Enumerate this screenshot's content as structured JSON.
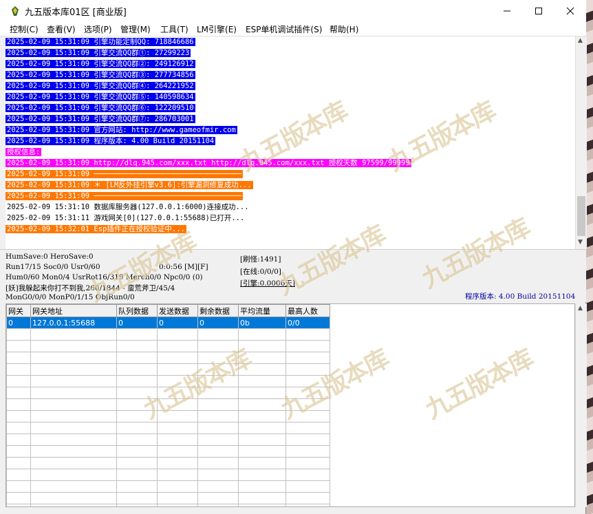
{
  "window": {
    "title": "九五版本库01区 [商业版]"
  },
  "menu": [
    "控制(C)",
    "查看(V)",
    "选项(P)",
    "管理(M)",
    "工具(T)",
    "LM引擎(E)",
    "ESP单机调试插件(S)",
    "帮助(H)"
  ],
  "log": [
    {
      "text": "2025-02-09 15:31:09 引擎功能定制QQ: 718846686",
      "style": "blue"
    },
    {
      "text": "2025-02-09 15:31:09 引擎交流QQ群①: 27299223",
      "style": "blue"
    },
    {
      "text": "2025-02-09 15:31:09 引擎交流QQ群②: 249126912",
      "style": "blue"
    },
    {
      "text": "2025-02-09 15:31:09 引擎交流QQ群③: 277734856",
      "style": "blue"
    },
    {
      "text": "2025-02-09 15:31:09 引擎交流QQ群④: 264221952",
      "style": "blue"
    },
    {
      "text": "2025-02-09 15:31:09 引擎交流QQ群⑤: 140598634",
      "style": "blue"
    },
    {
      "text": "2025-02-09 15:31:09 引擎交流QQ群⑥: 122209510",
      "style": "blue"
    },
    {
      "text": "2025-02-09 15:31:09 引擎交流QQ群⑦: 286703001",
      "style": "blue"
    },
    {
      "text": "2025-02-09 15:31:09 官方网站: http://www.gameofmir.com",
      "style": "blue"
    },
    {
      "text": "2025-02-09 15:31:09 程序版本: 4.00 Build 20151104",
      "style": "blue"
    },
    {
      "text": "授权信息:",
      "style": "magenta"
    },
    {
      "text": "2025-02-09 15:31:09 http://dlq.945.com/xxx.txt http://dlq.945.com/xxx.txt 授权天数 97599/99999",
      "style": "magenta"
    },
    {
      "text": "2025-02-09 15:31:09 ──────────────────────────────────",
      "style": "orange"
    },
    {
      "text": "2025-02-09 15:31:09 ＊ [LM反外挂引擎v3.6]:引擎漏洞修复成功...",
      "style": "orange"
    },
    {
      "text": "2025-02-09 15:31:09 ──────────────────────────────────",
      "style": "orange"
    },
    {
      "text": "2025-02-09 15:31:10 数据库服务器(127.0.0.1:6000)连接成功...",
      "style": "plain"
    },
    {
      "text": "2025-02-09 15:31:11 游戏网关[0](127.0.0.1:55688)已打开...",
      "style": "plain"
    },
    {
      "text": "2025-02-09 15:32:01 Esp插件正在授权验证中...",
      "style": "orange"
    }
  ],
  "status": {
    "line1": "HumSave:0 HeroSave:0",
    "line2a": "Run17/15 Soc0/0 Usr0/60",
    "line2b": "0:0:56 [M][F]",
    "line3": "Hum0/60 Mon0/4 UsrRot16/319 Merch0/0 Npc0/0 (0)",
    "line4": "[妖]我躲起来你打不到我,260/1844 - 蛮荒斧卫/45/4",
    "line5": "MonG0/0/0 MonP0/1/15 ObjRun0/0",
    "refresh": "[刷怪:1491]",
    "online": "[在线:0/0/0]",
    "engine": "[引擎:0.0006天]",
    "version": "程序版本: 4.00 Build 20151104"
  },
  "grid": {
    "headers": [
      "网关",
      "网关地址",
      "队列数据",
      "发送数据",
      "剩余数据",
      "平均流量",
      "最高人数"
    ],
    "rows": [
      [
        "0",
        "127.0.0.1:55688",
        "0",
        "0",
        "0",
        "0b",
        "0/0"
      ]
    ]
  },
  "watermark": "九五版本库",
  "colors": {
    "blue": "#0000ee",
    "magenta": "#ff00ff",
    "orange": "#ff7700",
    "select": "#0078d7"
  }
}
